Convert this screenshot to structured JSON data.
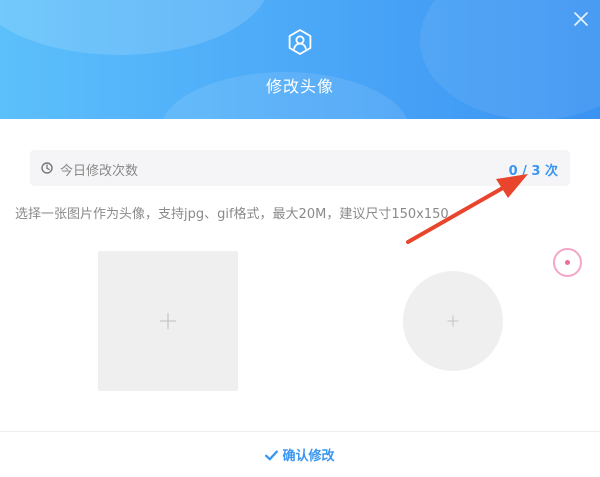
{
  "dialog": {
    "title": "修改头像",
    "header_icon": "user-shield-icon",
    "close_icon": "close-icon"
  },
  "count_bar": {
    "icon": "clock-icon",
    "label": "今日修改次数",
    "value": "0 / 3 次"
  },
  "hint": "选择一张图片作为头像，支持jpg、gif格式，最大20M，建议尺寸150x150",
  "uploads": {
    "square_icon": "plus-icon",
    "circle_icon": "plus-icon"
  },
  "footer": {
    "confirm_icon": "check-icon",
    "confirm_label": "确认修改"
  },
  "colors": {
    "header_start": "#5cc0fb",
    "header_end": "#3a93f2",
    "accent": "#3a96f0",
    "annotation_arrow": "#e8452c",
    "placeholder_bg": "#efefef"
  }
}
